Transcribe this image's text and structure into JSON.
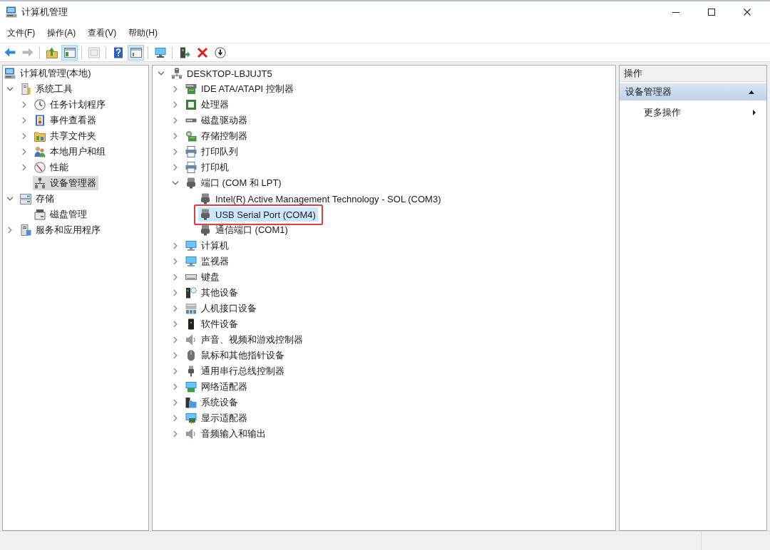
{
  "window": {
    "title": "计算机管理"
  },
  "menu_bar": [
    "文件(F)",
    "操作(A)",
    "查看(V)",
    "帮助(H)"
  ],
  "toolbar": [
    {
      "kind": "button",
      "on": false,
      "disabled": false
    },
    {
      "kind": "button",
      "on": false,
      "disabled": true
    },
    {
      "kind": "separator"
    },
    {
      "kind": "button",
      "on": false,
      "disabled": false
    },
    {
      "kind": "button",
      "on": true,
      "disabled": false
    },
    {
      "kind": "separator"
    },
    {
      "kind": "button",
      "on": false,
      "disabled": true
    },
    {
      "kind": "separator"
    },
    {
      "kind": "button",
      "on": false,
      "disabled": false
    },
    {
      "kind": "button",
      "on": true,
      "disabled": false
    },
    {
      "kind": "separator"
    },
    {
      "kind": "button",
      "on": false,
      "disabled": false
    },
    {
      "kind": "separator"
    },
    {
      "kind": "button",
      "on": false,
      "disabled": false
    },
    {
      "kind": "button",
      "on": false,
      "disabled": false
    },
    {
      "kind": "button",
      "on": false,
      "disabled": false
    }
  ],
  "console_tree": {
    "focused": false,
    "items": [
      {
        "label": "计算机管理(本地)",
        "selected": false,
        "children": [
          {
            "label": "系统工具",
            "expanded": true,
            "selected": false,
            "children": [
              {
                "label": "任务计划程序",
                "expanded": false,
                "selected": false
              },
              {
                "label": "事件查看器",
                "expanded": false,
                "selected": false
              },
              {
                "label": "共享文件夹",
                "expanded": false,
                "selected": false
              },
              {
                "label": "本地用户和组",
                "expanded": false,
                "selected": false
              },
              {
                "label": "性能",
                "expanded": false,
                "selected": false
              },
              {
                "label": "设备管理器",
                "selected": true
              }
            ]
          },
          {
            "label": "存储",
            "expanded": true,
            "selected": false,
            "children": [
              {
                "label": "磁盘管理",
                "selected": false
              }
            ]
          },
          {
            "label": "服务和应用程序",
            "expanded": false,
            "selected": false
          }
        ]
      }
    ]
  },
  "device_tree": {
    "focused": true,
    "items": [
      {
        "label": "DESKTOP-LBJUJT5",
        "expanded": true,
        "selected": false,
        "children": [
          {
            "label": "IDE ATA/ATAPI 控制器",
            "expanded": false,
            "selected": false
          },
          {
            "label": "处理器",
            "expanded": false,
            "selected": false
          },
          {
            "label": "磁盘驱动器",
            "expanded": false,
            "selected": false
          },
          {
            "label": "存储控制器",
            "expanded": false,
            "selected": false
          },
          {
            "label": "打印队列",
            "expanded": false,
            "selected": false
          },
          {
            "label": "打印机",
            "expanded": false,
            "selected": false
          },
          {
            "label": "端口 (COM 和 LPT)",
            "expanded": true,
            "selected": false,
            "children": [
              {
                "label": "Intel(R) Active Management Technology - SOL (COM3)",
                "selected": false,
                "outlined": false
              },
              {
                "label": "USB Serial Port (COM4)",
                "selected": true,
                "outlined": true
              },
              {
                "label": "通信端口 (COM1)",
                "selected": false,
                "outlined": false
              }
            ]
          },
          {
            "label": "计算机",
            "expanded": false,
            "selected": false
          },
          {
            "label": "监视器",
            "expanded": false,
            "selected": false
          },
          {
            "label": "键盘",
            "expanded": false,
            "selected": false
          },
          {
            "label": "其他设备",
            "expanded": false,
            "selected": false
          },
          {
            "label": "人机接口设备",
            "expanded": false,
            "selected": false
          },
          {
            "label": "软件设备",
            "expanded": false,
            "selected": false
          },
          {
            "label": "声音、视频和游戏控制器",
            "expanded": false,
            "selected": false
          },
          {
            "label": "鼠标和其他指针设备",
            "expanded": false,
            "selected": false
          },
          {
            "label": "通用串行总线控制器",
            "expanded": false,
            "selected": false
          },
          {
            "label": "网络适配器",
            "expanded": false,
            "selected": false
          },
          {
            "label": "系统设备",
            "expanded": false,
            "selected": false
          },
          {
            "label": "显示适配器",
            "expanded": false,
            "selected": false
          },
          {
            "label": "音频输入和输出",
            "expanded": false,
            "selected": false
          }
        ]
      }
    ]
  },
  "actions_pane": {
    "title": "操作",
    "sections": [
      {
        "label": "设备管理器",
        "expanded": true,
        "items": [
          {
            "label": "更多操作",
            "submenu": true
          }
        ]
      }
    ]
  }
}
